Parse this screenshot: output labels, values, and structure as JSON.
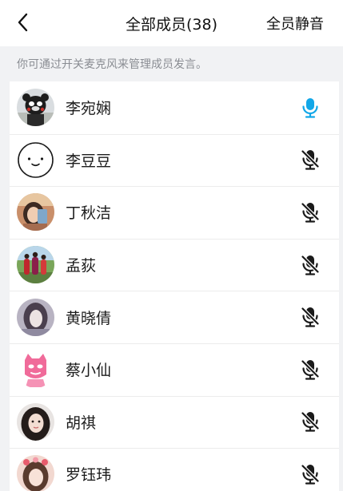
{
  "header": {
    "title": "全部成员(38)",
    "mute_all_label": "全员静音"
  },
  "hint_text": "你可通过开关麦克风来管理成员发言。",
  "members": [
    {
      "name": "李宛娴",
      "mic": "on"
    },
    {
      "name": "李豆豆",
      "mic": "off"
    },
    {
      "name": "丁秋洁",
      "mic": "off"
    },
    {
      "name": "孟荻",
      "mic": "off"
    },
    {
      "name": "黄晓倩",
      "mic": "off"
    },
    {
      "name": "蔡小仙",
      "mic": "off"
    },
    {
      "name": "胡祺",
      "mic": "off"
    },
    {
      "name": "罗钰玮",
      "mic": "off"
    }
  ],
  "colors": {
    "mic_on": "#12a7e8",
    "mic_off": "#1a1a1a",
    "hint": "#8a8d93",
    "background": "#f1f2f4"
  },
  "icons": {
    "back": "chevron-left-icon",
    "mic_on": "microphone-icon",
    "mic_off": "microphone-muted-icon"
  }
}
